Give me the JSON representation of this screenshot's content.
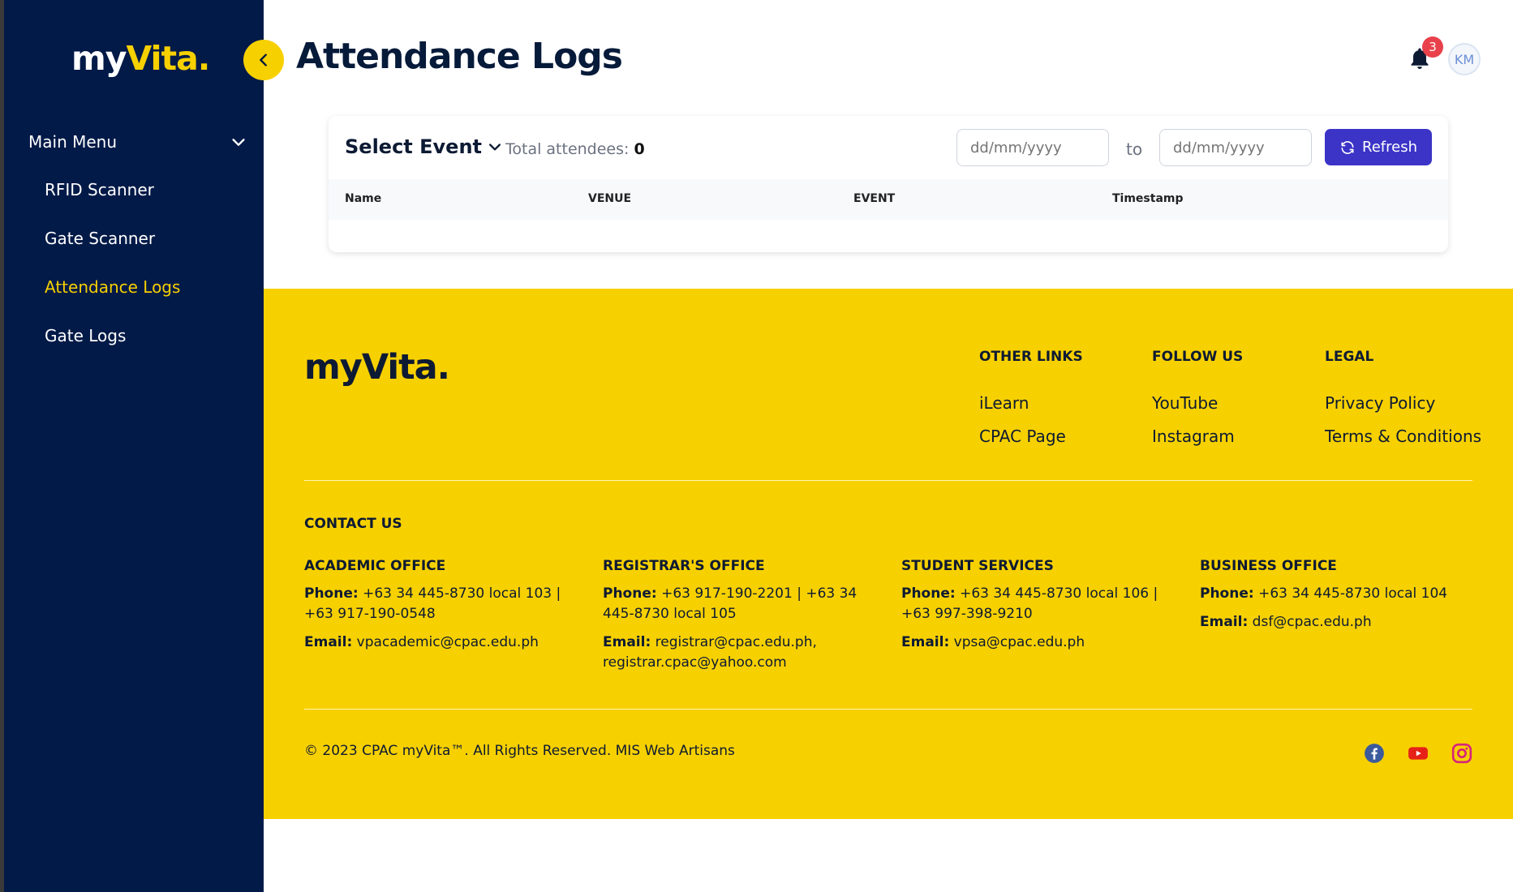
{
  "brand": {
    "part1": "my",
    "part2": "Vita."
  },
  "sidebar": {
    "menu_label": "Main Menu",
    "items": [
      {
        "label": "RFID Scanner"
      },
      {
        "label": "Gate Scanner"
      },
      {
        "label": "Attendance Logs"
      },
      {
        "label": "Gate Logs"
      }
    ]
  },
  "header": {
    "title": "Attendance Logs",
    "notification_count": "3",
    "avatar_initials": "KM"
  },
  "card": {
    "select_event_label": "Select Event",
    "total_label": "Total attendees:",
    "total_value": "0",
    "from_placeholder": "dd/mm/yyyy",
    "to_label": "to",
    "to_placeholder": "dd/mm/yyyy",
    "refresh_label": "Refresh",
    "columns": [
      "Name",
      "VENUE",
      "EVENT",
      "Timestamp"
    ]
  },
  "footer": {
    "brand": "myVita.",
    "other_links": {
      "heading": "OTHER LINKS",
      "links": [
        "iLearn",
        "CPAC Page"
      ]
    },
    "follow_us": {
      "heading": "FOLLOW US",
      "links": [
        "YouTube",
        "Instagram"
      ]
    },
    "legal": {
      "heading": "LEGAL",
      "links": [
        "Privacy Policy",
        "Terms & Conditions"
      ]
    },
    "contact_heading": "CONTACT US",
    "offices": [
      {
        "name": "ACADEMIC OFFICE",
        "phone_label": "Phone:",
        "phone": "+63 34 445-8730 local 103 | +63 917-190-0548",
        "email_label": "Email:",
        "email": "vpacademic@cpac.edu.ph"
      },
      {
        "name": "REGISTRAR'S OFFICE",
        "phone_label": "Phone:",
        "phone": "+63 917-190-2201 | +63 34 445-8730 local 105",
        "email_label": "Email:",
        "email": "registrar@cpac.edu.ph, registrar.cpac@yahoo.com"
      },
      {
        "name": "STUDENT SERVICES",
        "phone_label": "Phone:",
        "phone": "+63 34 445-8730 local 106 | +63 997-398-9210",
        "email_label": "Email:",
        "email": "vpsa@cpac.edu.ph"
      },
      {
        "name": "BUSINESS OFFICE",
        "phone_label": "Phone:",
        "phone": "+63 34 445-8730 local 104",
        "email_label": "Email:",
        "email": "dsf@cpac.edu.ph"
      }
    ],
    "copyright": "© 2023 CPAC myVita™. All Rights Reserved. MIS Web Artisans",
    "social_icons": [
      "facebook-icon",
      "youtube-icon",
      "instagram-icon"
    ]
  },
  "colors": {
    "sidebar_bg": "#021a48",
    "accent_yellow": "#f7d000",
    "refresh_button": "#3b34c7",
    "badge_red": "#e8414b"
  }
}
